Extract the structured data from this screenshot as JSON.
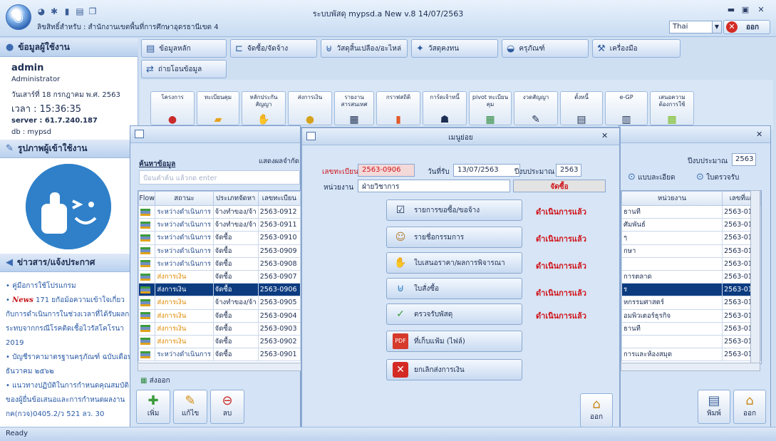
{
  "app": {
    "title": "ระบบพัสดุ mypsd.a  New  v.8   14/07/2563",
    "license": "ลิขสิทธิ์สำหรับ : สำนักงานเขตพื้นที่การศึกษาอุดรธานีเขต 4",
    "language": "Thai",
    "logout_label": "ออก",
    "status": "Ready"
  },
  "user_panel": {
    "heading": "ข้อมูลผู้ใช้งาน",
    "name": "admin",
    "role": "Administrator",
    "date": "วันเสาร์ที่ 18 กรกฎาคม พ.ศ. 2563",
    "time": "เวลา  : 15:36:35",
    "server": "server : 61.7.240.187",
    "db": "db : mypsd"
  },
  "photo_panel": {
    "heading": "รูปภาพผู้เข้าใช้งาน"
  },
  "news_panel": {
    "heading": "ข่าวสาร/แจ้งประกาศ",
    "items": [
      "คู่มือการใช้โปรแกรม",
      "171 ยกัอม้อความเข้าใจเกี่ยวกับการดำเนินการในช่วงเวลาที่ได้รับผลกระทบจากกรณีโรคติดเชื้อไวรัสโคโรนา 2019",
      "บัญชีราคามาตรฐานครุภัณฑ์ ฉบับเดือนธันวาคม ๒๕๖๒",
      "แนวทางปฏิบัติในการกำหนดคุณสมบัติของผู้ยื่นข้อเสนอและการกำหนดผลงาน กค(กวจ)0405.2/ว 521 ลว. 30"
    ],
    "news_badge": "News"
  },
  "menu": [
    {
      "label": "ข้อมูลหลัก",
      "icon": "document-icon"
    },
    {
      "label": "จัดซื้อ/จัดจ้าง",
      "icon": "cart-icon"
    },
    {
      "label": "วัสดุสิ้นเปลือง/อะไหล่",
      "icon": "basket-icon"
    },
    {
      "label": "วัสดุคงทน",
      "icon": "tools-icon"
    },
    {
      "label": "ครุภัณฑ์",
      "icon": "car-icon"
    },
    {
      "label": "เครื่องมือ",
      "icon": "wrench-icon"
    },
    {
      "label": "ถ่ายโอนข้อมูล",
      "icon": "transfer-icon"
    }
  ],
  "tools": [
    "โครงการ",
    "ทะเบียนคุม",
    "หลักประกันสัญญา",
    "ส่งการเงิน",
    "รายงานสารสนเทศ",
    "กราฟสถิติ",
    "การ์ดเจ้าหนี้",
    "pivot ทะเบียนคุม",
    "งวดสัญญา",
    "ตั้งหนี้",
    "e-GP",
    "เสนอความต้องการใช้"
  ],
  "list_window": {
    "search_label": "ค้นหาข้อมูล",
    "show_label": "แสดงผลจำกัด",
    "search_placeholder": "ป้อนคำค้น แล้วกด enter",
    "columns": [
      "Flow",
      "สถานะ",
      "ประเภทจัดหา",
      "เลขทะเบียน"
    ],
    "rows": [
      {
        "status": "ระหว่างดำเนินการ",
        "type": "จ้างทำของ/จ้า",
        "no": "2563-0912",
        "kind": "prog"
      },
      {
        "status": "ระหว่างดำเนินการ",
        "type": "จ้างทำของ/จ้า",
        "no": "2563-0911",
        "kind": "prog"
      },
      {
        "status": "ระหว่างดำเนินการ",
        "type": "จัดซื้อ",
        "no": "2563-0910",
        "kind": "prog"
      },
      {
        "status": "ระหว่างดำเนินการ",
        "type": "จัดซื้อ",
        "no": "2563-0909",
        "kind": "prog"
      },
      {
        "status": "ระหว่างดำเนินการ",
        "type": "จัดซื้อ",
        "no": "2563-0908",
        "kind": "prog"
      },
      {
        "status": "ส่งการเงิน",
        "type": "จัดซื้อ",
        "no": "2563-0907",
        "kind": "fin"
      },
      {
        "status": "ส่งการเงิน",
        "type": "จัดซื้อ",
        "no": "2563-0906",
        "kind": "sel"
      },
      {
        "status": "ส่งการเงิน",
        "type": "จ้างทำของ/จ้า",
        "no": "2563-0905",
        "kind": "fin"
      },
      {
        "status": "ส่งการเงิน",
        "type": "จัดซื้อ",
        "no": "2563-0904",
        "kind": "fin"
      },
      {
        "status": "ส่งการเงิน",
        "type": "จัดซื้อ",
        "no": "2563-0903",
        "kind": "fin"
      },
      {
        "status": "ส่งการเงิน",
        "type": "จัดซื้อ",
        "no": "2563-0902",
        "kind": "fin"
      },
      {
        "status": "ระหว่างดำเนินการ",
        "type": "จัดซื้อ",
        "no": "2563-0901",
        "kind": "prog"
      }
    ],
    "export_label": "ส่งออก",
    "add_label": "เพิ่ม",
    "edit_label": "แก้ไข",
    "delete_label": "ลบ"
  },
  "right_window": {
    "year_label": "ปีงบประมาณ",
    "year": "2563",
    "detail_label": "แบบละเอียด",
    "inspect_label": "ใบตรวจรับ",
    "columns": [
      "หน่วยงาน",
      "เลขที่แผ"
    ],
    "rows": [
      {
        "unit": "ธานที",
        "no": "2563-01"
      },
      {
        "unit": "ศัมพันธ์",
        "no": "2563-01"
      },
      {
        "unit": "ๆ",
        "no": "2563-01"
      },
      {
        "unit": "กษา",
        "no": "2563-01"
      },
      {
        "unit": "",
        "no": "2563-01"
      },
      {
        "unit": "การตลาด",
        "no": "2563-01"
      },
      {
        "unit": "ร",
        "no": "2563-01"
      },
      {
        "unit": "หกรรมศาสตร์",
        "no": "2563-01"
      },
      {
        "unit": "อมพิวเตอร์ธุรกิจ",
        "no": "2563-01"
      },
      {
        "unit": "ธานที",
        "no": "2563-01"
      },
      {
        "unit": "",
        "no": "2563-01"
      },
      {
        "unit": "การและห้องสมุด",
        "no": "2563-01"
      }
    ],
    "print_label": "พิมพ์",
    "exit_label": "ออก"
  },
  "dialog": {
    "title": "เมนูย่อย",
    "reg_label": "เลขทะเบียน",
    "reg_value": "2563-0906",
    "date_label": "วันที่รับ",
    "date_value": "13/07/2563",
    "year_label": "ปีงบประมาณ",
    "year_value": "2563",
    "unit_label": "หน่วยงาน",
    "unit_value": "ฝ่ายวิชาการ",
    "type_value": "จัดซื้อ",
    "done_text": "ดำเนินการแล้ว",
    "actions": [
      {
        "label": "รายการขอซื้อ/ขอจ้าง",
        "icon": "list-check-icon",
        "done": true
      },
      {
        "label": "รายชื่อกรรมการ",
        "icon": "committee-icon",
        "done": true
      },
      {
        "label": "ใบเสนอราคา/ผลการพิจารณา",
        "icon": "handshake-icon",
        "done": true
      },
      {
        "label": "ใบสั่งซื้อ",
        "icon": "cart-icon",
        "done": true
      },
      {
        "label": "ตรวจรับพัสดุ",
        "icon": "checklist-icon",
        "done": true
      },
      {
        "label": "ที่เก็บแฟ้ม (ไฟล์)",
        "icon": "pdf-icon",
        "done": false
      },
      {
        "label": "ยกเลิกส่งการเงิน",
        "icon": "cancel-icon",
        "done": false
      }
    ],
    "exit_label": "ออก"
  }
}
